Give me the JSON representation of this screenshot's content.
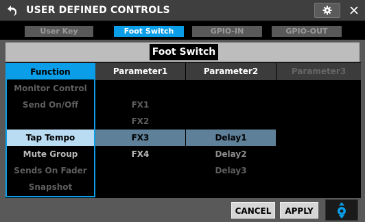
{
  "window": {
    "title": "USER DEFINED CONTROLS"
  },
  "tabs": [
    {
      "label": "User Key",
      "active": false
    },
    {
      "label": "Foot Switch",
      "active": true
    },
    {
      "label": "GPIO-IN",
      "active": false
    },
    {
      "label": "GPIO-OUT",
      "active": false
    }
  ],
  "section_title": "Foot Switch",
  "table": {
    "headers": {
      "function": "Function",
      "parameter1": "Parameter1",
      "parameter2": "Parameter2",
      "parameter3": "Parameter3"
    },
    "functions": [
      {
        "label": "Monitor Control"
      },
      {
        "label": "Send On/Off"
      },
      {
        "label": ""
      },
      {
        "label": "Tap Tempo",
        "selected": true
      },
      {
        "label": "Mute Group"
      },
      {
        "label": "Sends On Fader"
      },
      {
        "label": "Snapshot"
      }
    ],
    "parameter1": [
      {
        "label": ""
      },
      {
        "label": "FX1"
      },
      {
        "label": "FX2"
      },
      {
        "label": "FX3",
        "selected": true
      },
      {
        "label": "FX4"
      }
    ],
    "parameter2": [
      {
        "label": "Delay1",
        "selected": true
      },
      {
        "label": "Delay2"
      },
      {
        "label": "Delay3"
      }
    ]
  },
  "buttons": {
    "cancel": "CANCEL",
    "apply": "APPLY"
  },
  "icons": {
    "back": "back-arrow-icon",
    "settings": "gear-icon",
    "close": "close-icon",
    "knob": "encoder-knob-icon"
  },
  "colors": {
    "accent": "#0a9ee8",
    "selected_row": "#b9dcf3",
    "selected_param": "#5e8098"
  }
}
